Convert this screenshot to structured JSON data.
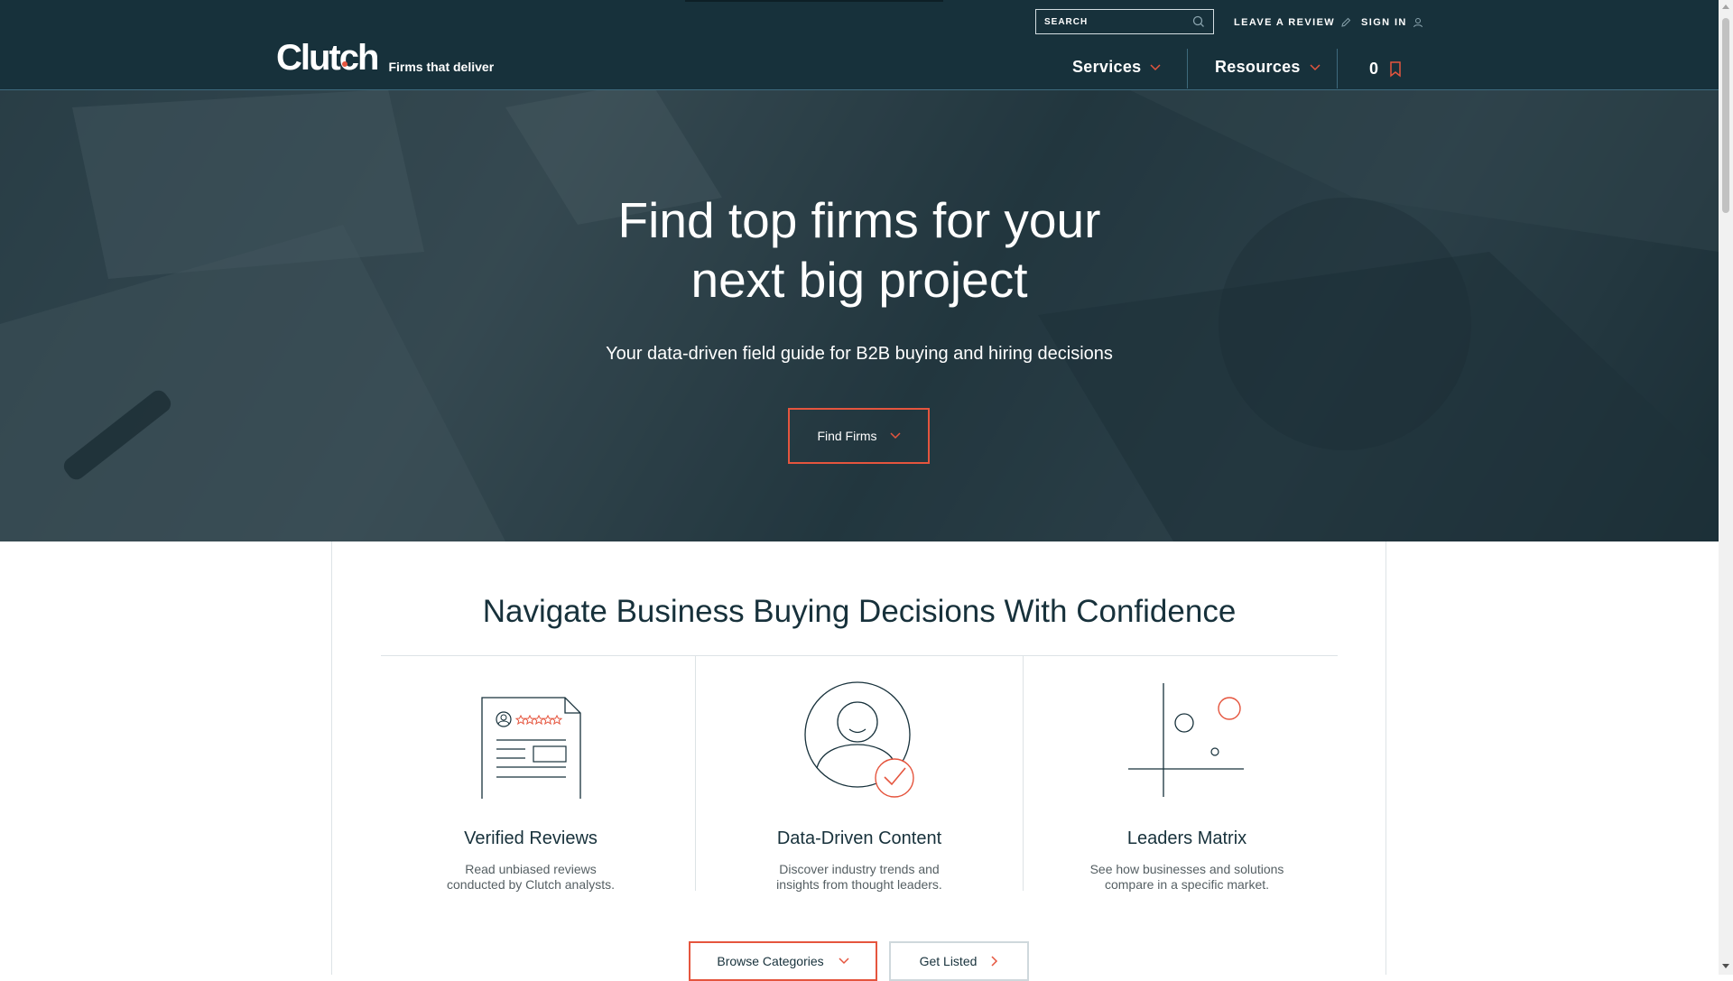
{
  "brand": {
    "name": "Clutch",
    "tagline": "Firms that deliver",
    "accent_color": "#e5553e",
    "header_color": "#17313b"
  },
  "topbar": {
    "search_placeholder": "SEARCH",
    "search_icon": "search-icon",
    "leave_review_label": "LEAVE A REVIEW",
    "leave_review_icon": "pencil-icon",
    "sign_in_label": "SIGN IN",
    "sign_in_icon": "user-icon"
  },
  "nav": {
    "services_label": "Services",
    "resources_label": "Resources",
    "bookmark_count": "0",
    "bookmark_icon": "bookmark-icon"
  },
  "hero": {
    "title_line1": "Find top firms for your",
    "title_line2": "next big project",
    "subtitle": "Your data-driven field guide for B2B buying and hiring decisions",
    "find_firms_label": "Find Firms"
  },
  "main": {
    "section_title": "Navigate Business Buying Decisions With Confidence",
    "features": [
      {
        "icon": "review-document-icon",
        "title": "Verified Reviews",
        "desc_line1": "Read unbiased reviews",
        "desc_line2": "conducted by Clutch analysts."
      },
      {
        "icon": "verified-user-icon",
        "title": "Data-Driven Content",
        "desc_line1": "Discover industry trends and",
        "desc_line2": "insights from thought leaders."
      },
      {
        "icon": "matrix-chart-icon",
        "title": "Leaders Matrix",
        "desc_line1": "See how businesses and solutions",
        "desc_line2": "compare in a specific market."
      }
    ],
    "browse_categories_label": "Browse Categories",
    "get_listed_label": "Get Listed"
  }
}
